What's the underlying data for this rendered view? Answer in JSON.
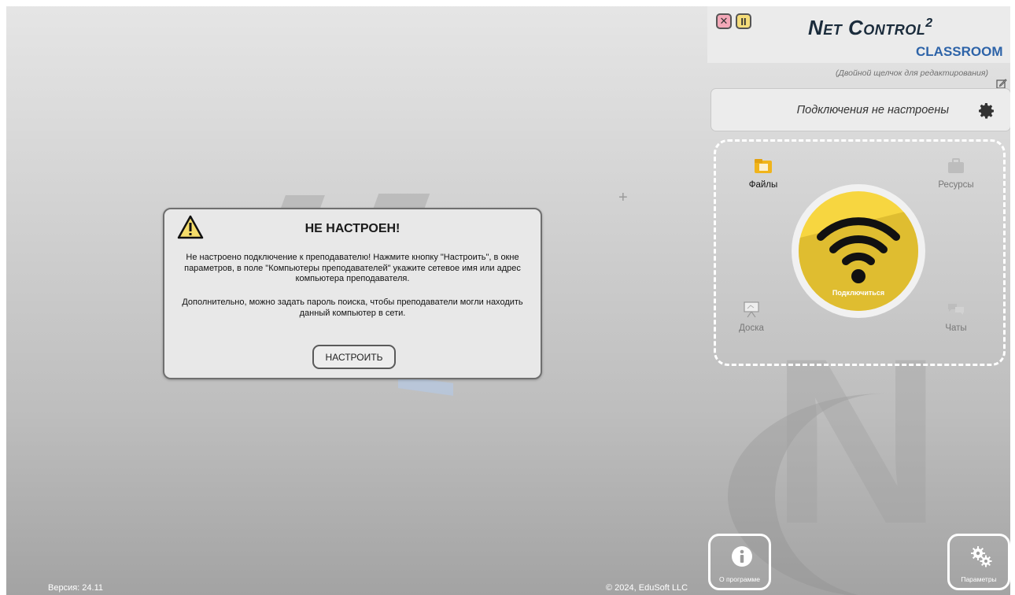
{
  "window": {
    "close_icon": "close-x-icon",
    "pause_icon": "pause-icon"
  },
  "brand": {
    "title": "Net Control",
    "title_sup": "2",
    "subtitle": "CLASSROOM",
    "edit_hint": "(Двойной щелчок для редактирования)"
  },
  "connection": {
    "status_text": "Подключения не настроены",
    "settings_icon": "gear-icon"
  },
  "tools": {
    "files": "Файлы",
    "resources": "Ресурсы",
    "board": "Доска",
    "chats": "Чаты"
  },
  "connect_button": {
    "label": "Подключиться",
    "icon": "wifi-icon",
    "color": "#f7d640"
  },
  "dialog": {
    "title": "НЕ НАСТРОЕН!",
    "message_1": "Не настроено подключение к преподавателю! Нажмите кнопку \"Настроить\", в окне параметров, в поле \"Компьютеры преподавателей\" укажите сетевое имя или адрес компьютера преподавателя.",
    "message_2": "Дополнительно, можно задать пароль поиска, чтобы преподаватели могли находить данный компьютер в сети.",
    "button_label": "НАСТРОИТЬ",
    "icon": "warning-icon"
  },
  "footer": {
    "version": "Версия: 24.11",
    "copyright": "© 2024, EduSoft LLC",
    "about_label": "О программе",
    "params_label": "Параметры"
  }
}
